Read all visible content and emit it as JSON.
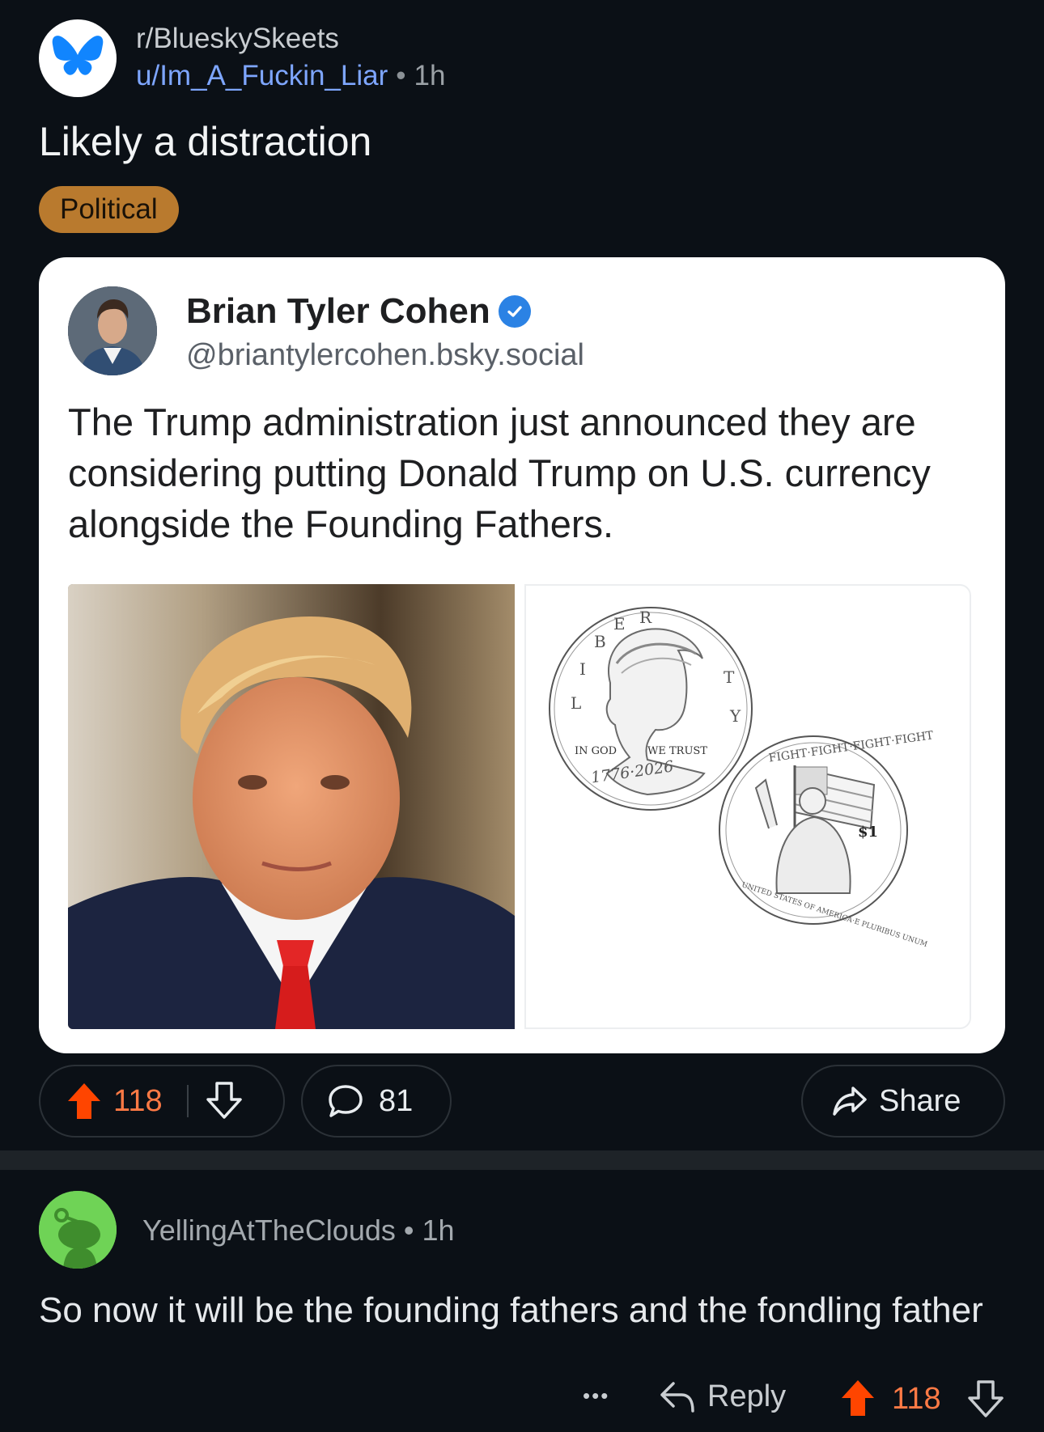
{
  "post": {
    "subreddit": "r/BlueskySkeets",
    "author": "u/Im_A_Fuckin_Liar",
    "separator": "•",
    "age": "1h",
    "title": "Likely a distraction",
    "flair": "Political",
    "subreddit_icon": "bluesky-butterfly-icon"
  },
  "embed": {
    "author_name": "Brian Tyler Cohen",
    "handle": "@briantylercohen.bsky.social",
    "text": "The Trump administration just announced they are considering putting Donald Trump on U.S. currency alongside the Founding Fathers.",
    "coin_front": {
      "legend_letters": [
        "L",
        "I",
        "B",
        "E",
        "R",
        "T",
        "Y"
      ],
      "motto_left": "IN GOD",
      "motto_right": "WE TRUST",
      "years": "1776·2026"
    },
    "coin_back": {
      "top_text": "FIGHT·FIGHT·FIGHT·FIGHT",
      "bottom_text": "UNITED STATES OF AMERICA·E PLURIBUS UNUM",
      "value": "$1"
    }
  },
  "actions": {
    "upvotes": "118",
    "comments": "81",
    "share_label": "Share"
  },
  "comment": {
    "author": "YellingAtTheClouds",
    "separator": "•",
    "age": "1h",
    "text": "So now it will be the founding fathers and the fondling father",
    "more_label": "•••",
    "reply_label": "Reply",
    "upvotes": "118"
  },
  "colors": {
    "background": "#0b1016",
    "upvote_active": "#ff4500",
    "link_blue": "#7ea6ff",
    "flair_bg": "#b97a2e",
    "bluesky_blue": "#1185fe",
    "verified_blue": "#2b82e4",
    "snoo_green": "#6fd356"
  }
}
